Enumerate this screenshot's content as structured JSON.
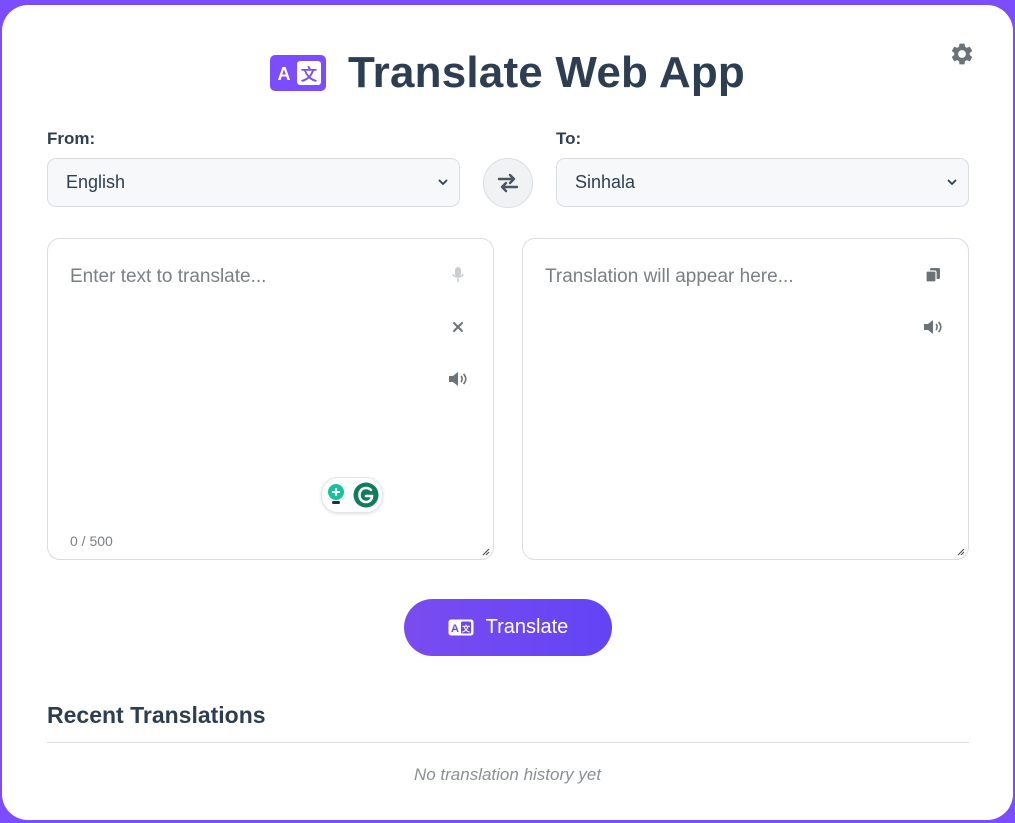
{
  "header": {
    "title": "Translate Web App",
    "logo_icon": "translate-icon",
    "settings_icon": "gear-icon"
  },
  "from": {
    "label": "From:",
    "selected": "English"
  },
  "to": {
    "label": "To:",
    "selected": "Sinhala"
  },
  "input": {
    "placeholder": "Enter text to translate...",
    "counter": "0 / 500",
    "icons": [
      "microphone-icon",
      "clear-icon",
      "speaker-icon"
    ]
  },
  "output": {
    "placeholder": "Translation will appear here...",
    "icons": [
      "copy-icon",
      "speaker-icon"
    ]
  },
  "translate_button": {
    "label": "Translate"
  },
  "recent": {
    "title": "Recent Translations",
    "empty_text": "No translation history yet"
  },
  "colors": {
    "accent": "#7c4dff",
    "text": "#2e3e52",
    "muted": "#7a7f86",
    "grammarly": "#15c39a"
  }
}
